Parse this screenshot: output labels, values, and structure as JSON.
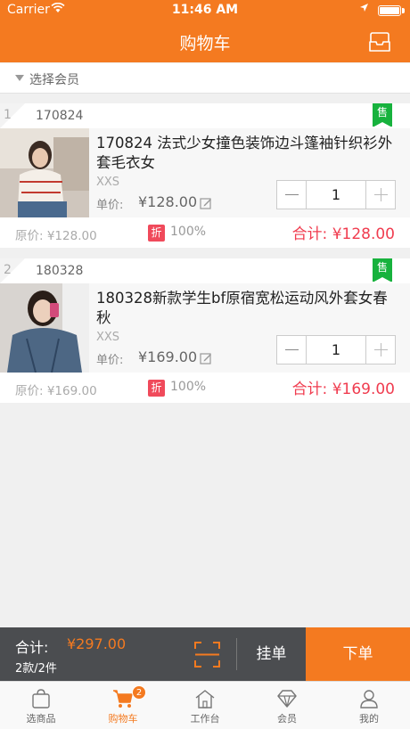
{
  "status_bar": {
    "carrier": "Carrier",
    "time": "11:46 AM"
  },
  "nav": {
    "title": "购物车"
  },
  "member": {
    "label": "选择会员"
  },
  "items": [
    {
      "index": "1",
      "code": "170824",
      "sold_tag": "售",
      "name": "170824 法式少女撞色装饰边斗篷袖针织衫外套毛衣女",
      "spec": "XXS",
      "unit_price_label": "单价:",
      "unit_price": "¥128.00",
      "quantity": "1",
      "original_price": "原价: ¥128.00",
      "discount_badge": "折",
      "discount": "100%",
      "total": "合计: ¥128.00"
    },
    {
      "index": "2",
      "code": "180328",
      "sold_tag": "售",
      "name": "180328新款学生bf原宿宽松运动风外套女春秋",
      "spec": "XXS",
      "unit_price_label": "单价:",
      "unit_price": "¥169.00",
      "quantity": "1",
      "original_price": "原价: ¥169.00",
      "discount_badge": "折",
      "discount": "100%",
      "total": "合计: ¥169.00"
    }
  ],
  "summary": {
    "total_label": "合计:",
    "total_value": "¥297.00",
    "count": "2款/2件",
    "hold_label": "挂单",
    "order_label": "下单"
  },
  "tabs": [
    {
      "label": "选商品",
      "icon": "bag-icon"
    },
    {
      "label": "购物车",
      "icon": "cart-icon",
      "badge": "2"
    },
    {
      "label": "工作台",
      "icon": "home-icon"
    },
    {
      "label": "会员",
      "icon": "diamond-icon"
    },
    {
      "label": "我的",
      "icon": "person-icon"
    }
  ],
  "colors": {
    "accent": "#f47a20",
    "price_red": "#f03c4f",
    "sold_green": "#17b23d",
    "bottom_bar": "#4b4d50"
  }
}
